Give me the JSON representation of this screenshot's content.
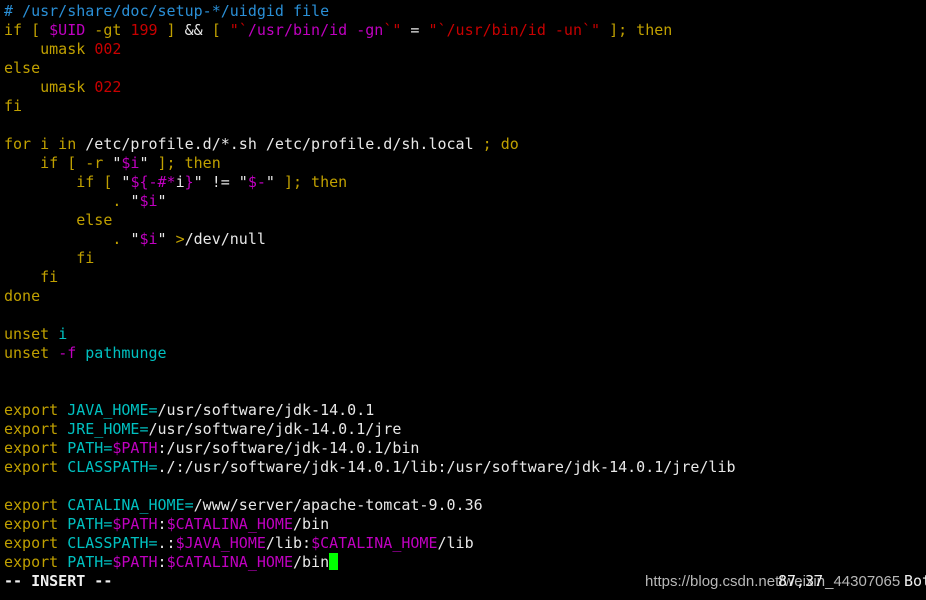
{
  "colors": {
    "comment": "#2a8fd6",
    "keyword": "#c0a000",
    "number": "#c80000",
    "string": "#c80000",
    "var": "#c000c0",
    "ident": "#00c0c0",
    "text": "#e8e8e8",
    "cursor": "#00ff00"
  },
  "lines": [
    [
      [
        "# /usr/share/doc/setup-*/uidgid file",
        "comment"
      ]
    ],
    [
      [
        "if [ ",
        "keyword"
      ],
      [
        "$UID",
        "var"
      ],
      [
        " -gt ",
        "keyword"
      ],
      [
        "199",
        "number"
      ],
      [
        " ] ",
        "keyword"
      ],
      [
        "&& ",
        "text"
      ],
      [
        "[ ",
        "keyword"
      ],
      [
        "\"`",
        "string"
      ],
      [
        "/usr/bin/id -gn",
        "var"
      ],
      [
        "`\"",
        "string"
      ],
      [
        " = ",
        "text"
      ],
      [
        "\"`/usr/bin/id -un`\"",
        "string"
      ],
      [
        " ]; then",
        "keyword"
      ]
    ],
    [
      [
        "    umask ",
        "keyword"
      ],
      [
        "002",
        "number"
      ]
    ],
    [
      [
        "else",
        "keyword"
      ]
    ],
    [
      [
        "    umask ",
        "keyword"
      ],
      [
        "022",
        "number"
      ]
    ],
    [
      [
        "fi",
        "keyword"
      ]
    ],
    [],
    [
      [
        "for i in ",
        "keyword"
      ],
      [
        "/etc/profile.d/*.sh /etc/profile.d/sh.local ",
        "text"
      ],
      [
        "; do",
        "keyword"
      ]
    ],
    [
      [
        "    if [ -r ",
        "keyword"
      ],
      [
        "\"",
        "text"
      ],
      [
        "$i",
        "var"
      ],
      [
        "\"",
        "text"
      ],
      [
        " ]; then",
        "keyword"
      ]
    ],
    [
      [
        "        if [ ",
        "keyword"
      ],
      [
        "\"",
        "text"
      ],
      [
        "${-#*",
        "var"
      ],
      [
        "i",
        "text"
      ],
      [
        "}",
        "var"
      ],
      [
        "\" != \"",
        "text"
      ],
      [
        "$-",
        "var"
      ],
      [
        "\"",
        "text"
      ],
      [
        " ]; then",
        "keyword"
      ]
    ],
    [
      [
        "            . ",
        "keyword"
      ],
      [
        "\"",
        "text"
      ],
      [
        "$i",
        "var"
      ],
      [
        "\"",
        "text"
      ]
    ],
    [
      [
        "        else",
        "keyword"
      ]
    ],
    [
      [
        "            . ",
        "keyword"
      ],
      [
        "\"",
        "text"
      ],
      [
        "$i",
        "var"
      ],
      [
        "\" ",
        "text"
      ],
      [
        ">",
        "keyword"
      ],
      [
        "/dev/null",
        "text"
      ]
    ],
    [
      [
        "        fi",
        "keyword"
      ]
    ],
    [
      [
        "    fi",
        "keyword"
      ]
    ],
    [
      [
        "done",
        "keyword"
      ]
    ],
    [],
    [
      [
        "unset ",
        "keyword"
      ],
      [
        "i",
        "ident"
      ]
    ],
    [
      [
        "unset ",
        "keyword"
      ],
      [
        "-f ",
        "var"
      ],
      [
        "pathmunge",
        "ident"
      ]
    ],
    [],
    [],
    [
      [
        "export ",
        "keyword"
      ],
      [
        "JAVA_HOME=",
        "ident"
      ],
      [
        "/usr/software/jdk-14.0.1",
        "text"
      ]
    ],
    [
      [
        "export ",
        "keyword"
      ],
      [
        "JRE_HOME=",
        "ident"
      ],
      [
        "/usr/software/jdk-14.0.1/jre",
        "text"
      ]
    ],
    [
      [
        "export ",
        "keyword"
      ],
      [
        "PATH=",
        "ident"
      ],
      [
        "$PATH",
        "var"
      ],
      [
        ":/usr/software/jdk-14.0.1/bin",
        "text"
      ]
    ],
    [
      [
        "export ",
        "keyword"
      ],
      [
        "CLASSPATH=",
        "ident"
      ],
      [
        "./:/usr/software/jdk-14.0.1/lib:/usr/software/jdk-14.0.1/jre/lib",
        "text"
      ]
    ],
    [],
    [
      [
        "export ",
        "keyword"
      ],
      [
        "CATALINA_HOME=",
        "ident"
      ],
      [
        "/www/server/apache-tomcat-9.0.36",
        "text"
      ]
    ],
    [
      [
        "export ",
        "keyword"
      ],
      [
        "PATH=",
        "ident"
      ],
      [
        "$PATH",
        "var"
      ],
      [
        ":",
        "text"
      ],
      [
        "$CATALINA_HOME",
        "var"
      ],
      [
        "/bin",
        "text"
      ]
    ],
    [
      [
        "export ",
        "keyword"
      ],
      [
        "CLASSPATH=",
        "ident"
      ],
      [
        ".:",
        "text"
      ],
      [
        "$JAVA_HOME",
        "var"
      ],
      [
        "/lib:",
        "text"
      ],
      [
        "$CATALINA_HOME",
        "var"
      ],
      [
        "/lib",
        "text"
      ]
    ],
    [
      [
        "export ",
        "keyword"
      ],
      [
        "PATH=",
        "ident"
      ],
      [
        "$PATH",
        "var"
      ],
      [
        ":",
        "text"
      ],
      [
        "$CATALINA_HOME",
        "var"
      ],
      [
        "/bin",
        "text"
      ]
    ]
  ],
  "status": {
    "mode": "-- INSERT --",
    "ruler": "87,37",
    "position": "Bot"
  },
  "watermark": "https://blog.csdn.net/weixin_44307065"
}
